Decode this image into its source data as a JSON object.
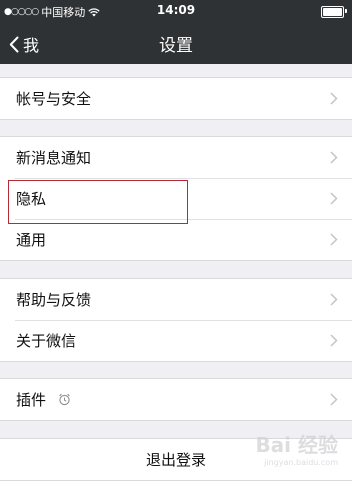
{
  "status_bar": {
    "carrier": "中国移动",
    "time": "14:09"
  },
  "nav": {
    "back_label": "我",
    "title": "设置"
  },
  "groups": [
    {
      "items": [
        {
          "label": "帐号与安全"
        }
      ]
    },
    {
      "items": [
        {
          "label": "新消息通知"
        },
        {
          "label": "隐私"
        },
        {
          "label": "通用"
        }
      ]
    },
    {
      "items": [
        {
          "label": "帮助与反馈"
        },
        {
          "label": "关于微信"
        }
      ]
    },
    {
      "items": [
        {
          "label": "插件",
          "icon": "plugin-alarm-icon"
        }
      ]
    }
  ],
  "logout_label": "退出登录",
  "highlighted_item": "隐私",
  "colors": {
    "bar_background": "#2f3234",
    "page_background": "#efeff4",
    "highlight_border": "#b52a36"
  },
  "watermark": {
    "text": "Bai 经验",
    "sub": "jingyan.baidu.com"
  }
}
